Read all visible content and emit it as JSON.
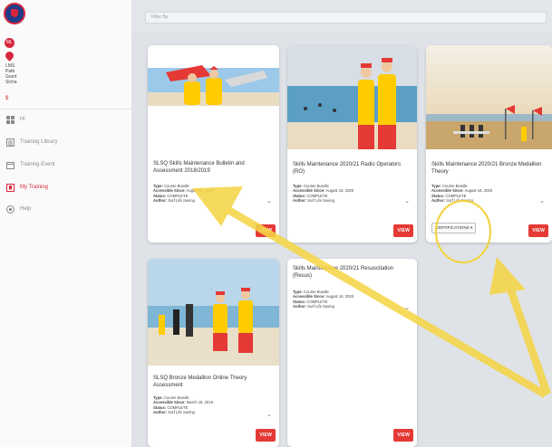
{
  "filter": {
    "placeholder": "Filter By"
  },
  "user": {
    "initials": "ML",
    "lines": [
      "LMS",
      "Patti",
      "Goort",
      "Sicha"
    ],
    "extra": "$"
  },
  "sidebar": {
    "items": [
      {
        "label": "Hi",
        "icon": "grid-icon"
      },
      {
        "label": "Training Library",
        "icon": "library-icon"
      },
      {
        "label": "Training Event",
        "icon": "calendar-icon"
      },
      {
        "label": "My Training",
        "icon": "bookmark-icon",
        "active": true
      },
      {
        "label": "Help",
        "icon": "help-icon"
      }
    ]
  },
  "cards": [
    {
      "title": "SLSQ Skills Maintenance Bulletin and Assessment 2018/2019",
      "type": "Course Bundle",
      "accessible": "August 16, 2019",
      "status": "COMPLETE",
      "author": "Surf Life Saving",
      "view": "VIEW"
    },
    {
      "title": "Skills Maintenance 2020/21 Radio Operators (RO)",
      "type": "Course Bundle",
      "accessible": "August 16, 2020",
      "status": "COMPLETE",
      "author": "Surf Life Saving",
      "view": "VIEW"
    },
    {
      "title": "Skills Maintenance 2020/21 Bronze Medallion Theory",
      "type": "Course Bundle",
      "accessible": "August 16, 2020",
      "status": "COMPLETE",
      "author": "Surf Life Saving",
      "view": "VIEW",
      "certifications": "CERTIFICATIONS"
    },
    {
      "title": "SLSQ Bronze Medallion Online Theory Assessment",
      "type": "Course Bundle",
      "accessible": "March 18, 2019",
      "status": "COMPLETE",
      "author": "Surf Life Saving",
      "view": "VIEW"
    },
    {
      "title": "Skills Maintenance 2020/21 Resuscitation (Resus)",
      "type": "Course Bundle",
      "accessible": "August 16, 2020",
      "status": "COMPLETE",
      "author": "Surf Life Saving",
      "view": "VIEW"
    }
  ],
  "meta_labels": {
    "type": "Type:",
    "accessible": "Accessible Since:",
    "status": "Status:",
    "author": "Author:"
  },
  "colors": {
    "accent": "#e53935",
    "brand_blue": "#1f3c88",
    "annotation": "#f5d547"
  }
}
